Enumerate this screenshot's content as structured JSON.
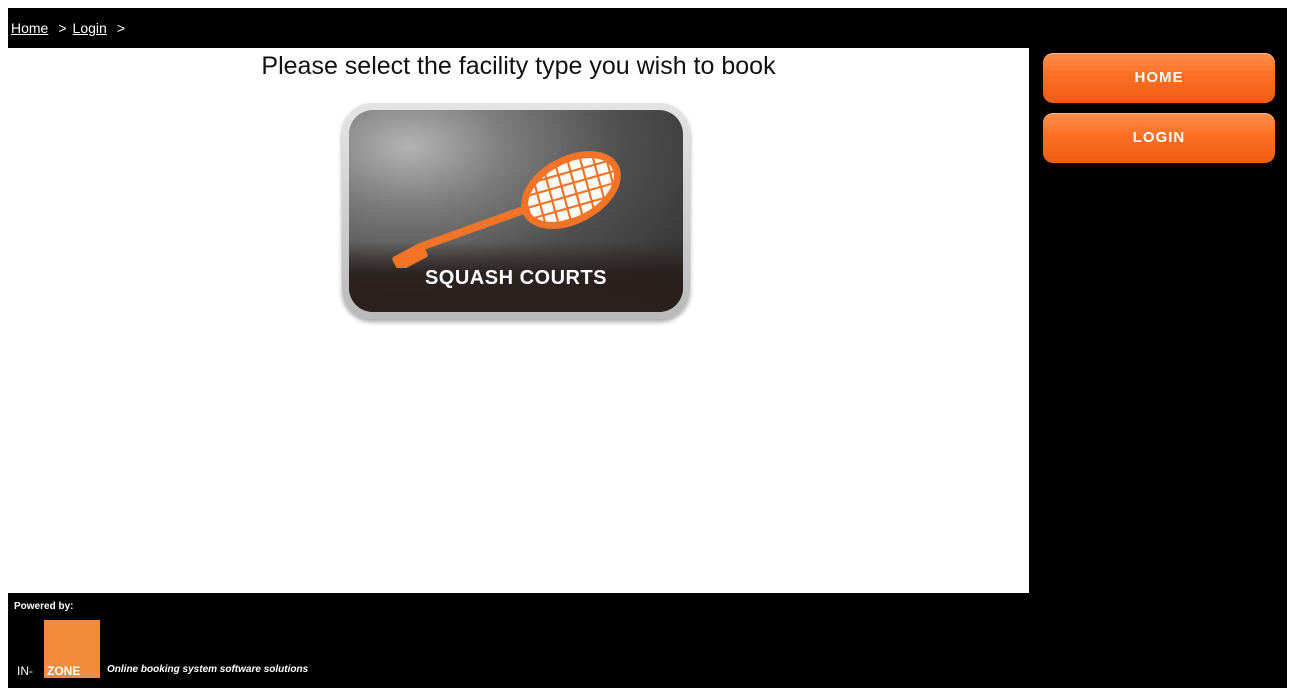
{
  "breadcrumb": {
    "items": [
      "Home",
      "Login"
    ],
    "separator": ">"
  },
  "main": {
    "title": "Please select the facility type you wish to book",
    "facilities": [
      {
        "label": "SQUASH COURTS",
        "icon": "squash-racket-icon"
      }
    ]
  },
  "sidebar": {
    "buttons": [
      {
        "label": "HOME"
      },
      {
        "label": "LOGIN"
      }
    ]
  },
  "footer": {
    "powered_by": "Powered by:",
    "logo_prefix": "IN-",
    "logo_word": "ZONE",
    "tagline": "Online booking system software solutions"
  },
  "colors": {
    "accent_orange": "#f97226",
    "logo_orange": "#f58c3c",
    "background": "#000000",
    "panel": "#ffffff"
  }
}
